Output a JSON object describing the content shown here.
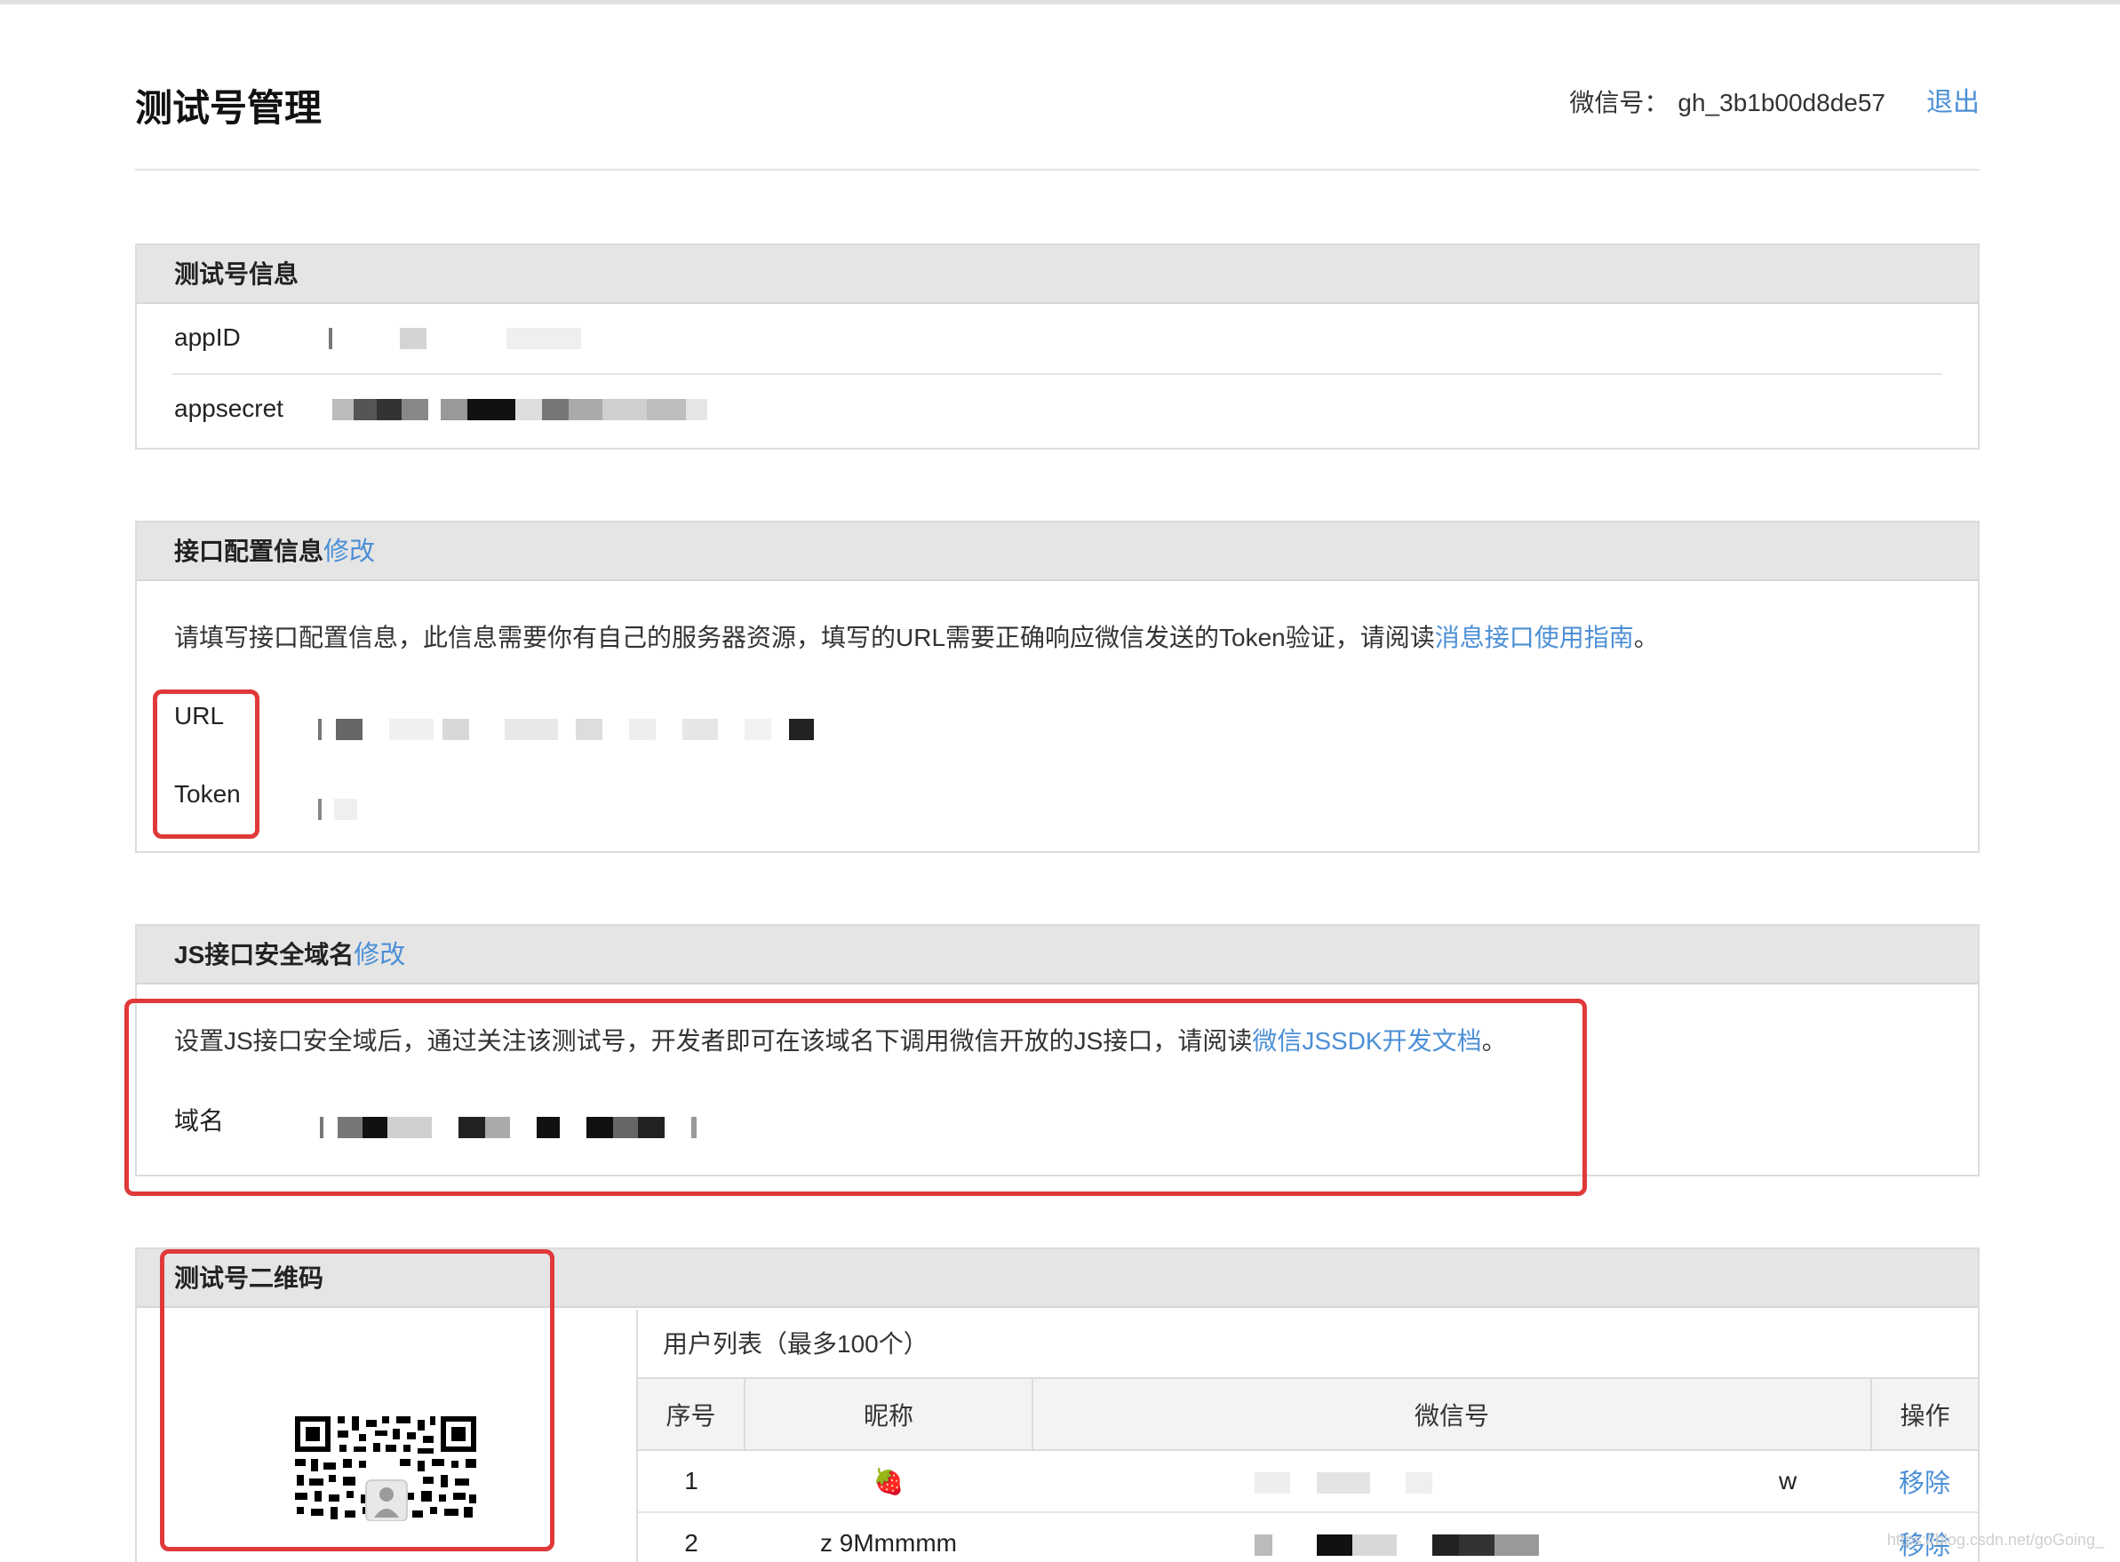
{
  "header": {
    "title": "测试号管理",
    "account_label": "微信号：",
    "account_id": "gh_3b1b00d8de57",
    "logout": "退出"
  },
  "test_info": {
    "title": "测试号信息",
    "rows": [
      {
        "label": "appID"
      },
      {
        "label": "appsecret"
      }
    ]
  },
  "interface_config": {
    "title": "接口配置信息",
    "edit": "修改",
    "desc": "请填写接口配置信息，此信息需要你有自己的服务器资源，填写的URL需要正确响应微信发送的Token验证，请阅读",
    "link": "消息接口使用指南",
    "period": "。",
    "url_label": "URL",
    "token_label": "Token"
  },
  "js_domain": {
    "title": "JS接口安全域名",
    "edit": "修改",
    "desc": "设置JS接口安全域后，通过关注该测试号，开发者即可在该域名下调用微信开放的JS接口，请阅读",
    "link": "微信JSSDK开发文档",
    "period": "。",
    "domain_label": "域名"
  },
  "qrcode": {
    "title": "测试号二维码"
  },
  "user_list": {
    "title": "用户列表（最多100个）",
    "columns": [
      "序号",
      "昵称",
      "微信号",
      "操作"
    ],
    "rows": [
      {
        "index": "1",
        "nickname": "🍓",
        "wechat_suffix": "w",
        "action": "移除"
      },
      {
        "index": "2",
        "nickname": "z 9Mmmmm",
        "wechat_suffix": "",
        "action": "移除"
      }
    ]
  },
  "watermark": "https://blog.csdn.net/goGoing_"
}
